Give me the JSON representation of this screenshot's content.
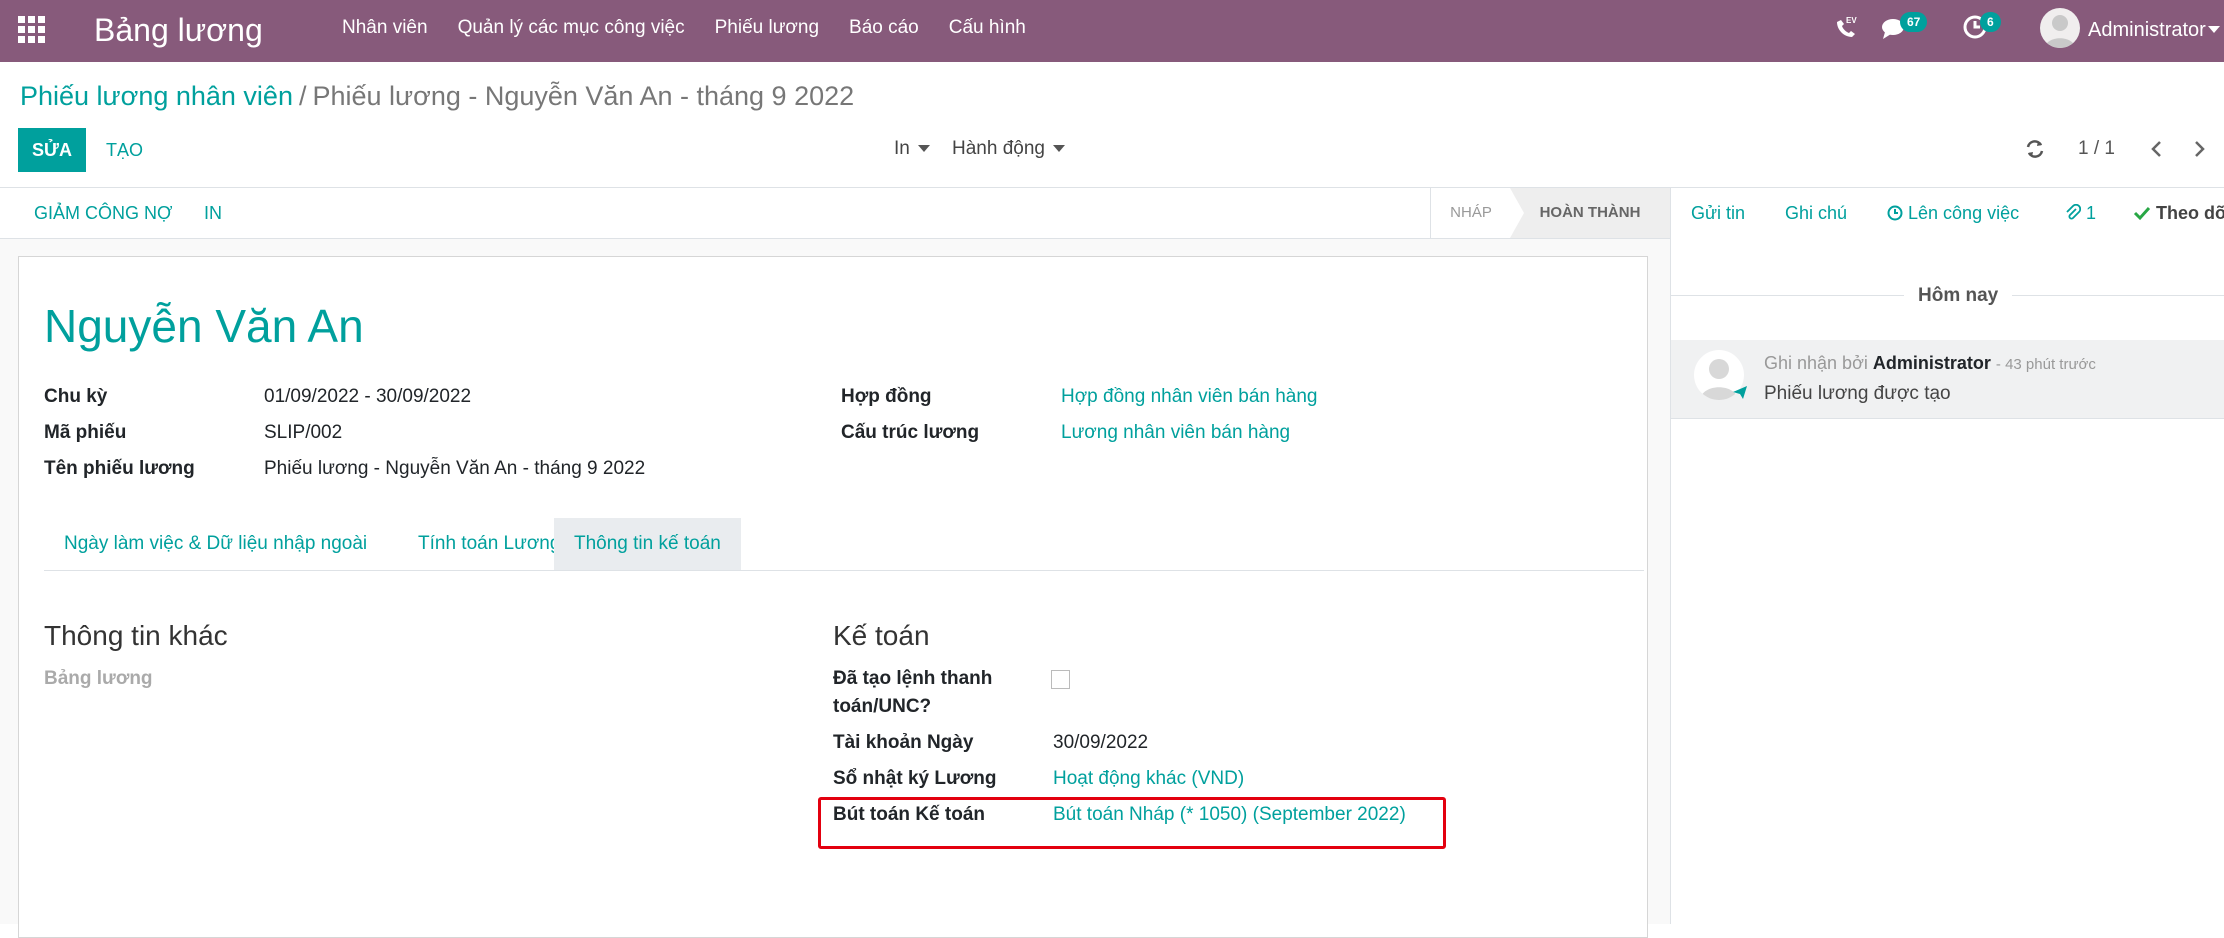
{
  "navbar": {
    "app_title": "Bảng lương",
    "menu": [
      "Nhân viên",
      "Quản lý các mục công việc",
      "Phiếu lương",
      "Báo cáo",
      "Cấu hình"
    ],
    "phone_label": "EV",
    "messages_count": "67",
    "activities_count": "6",
    "user_name": "Administrator",
    "colors": {
      "bar": "#875a7b",
      "badge": "#00a09d"
    }
  },
  "control_panel": {
    "breadcrumb_parent": "Phiếu lương nhân viên",
    "breadcrumb_separator": "/",
    "breadcrumb_current": "Phiếu lương - Nguyễn Văn An - tháng 9 2022",
    "edit_label": "SỬA",
    "create_label": "TẠO",
    "print_label": "In",
    "action_label": "Hành động",
    "pager": "1 / 1"
  },
  "statusbar": {
    "buttons": [
      "GIẢM CÔNG NỢ",
      "IN"
    ],
    "stages": [
      "NHÁP",
      "HOÀN THÀNH"
    ],
    "active_stage": "HOÀN THÀNH"
  },
  "form": {
    "employee_name": "Nguyễn Văn An",
    "left_fields": [
      {
        "label": "Chu kỳ",
        "value": "01/09/2022 - 30/09/2022"
      },
      {
        "label": "Mã phiếu",
        "value": "SLIP/002"
      },
      {
        "label": "Tên phiếu lương",
        "value": "Phiếu lương - Nguyễn Văn An - tháng 9 2022"
      }
    ],
    "right_fields": [
      {
        "label": "Hợp đồng",
        "value": "Hợp đồng nhân viên bán hàng"
      },
      {
        "label": "Cấu trúc lương",
        "value": "Lương nhân viên bán hàng"
      }
    ],
    "tabs": [
      "Ngày làm việc & Dữ liệu nhập ngoài",
      "Tính toán Lương",
      "Thông tin kế toán"
    ],
    "active_tab": "Thông tin kế toán",
    "other_info": {
      "title": "Thông tin khác",
      "field_label": "Bảng lương"
    },
    "accounting": {
      "title": "Kế toán",
      "payment_label": "Đã tạo lệnh thanh toán/UNC?",
      "payment_label_line1": "Đã tạo lệnh thanh",
      "payment_label_line2": "toán/UNC?",
      "payment_checked": false,
      "date_label": "Tài khoản Ngày",
      "date_value": "30/09/2022",
      "journal_label": "Sổ nhật ký Lương",
      "journal_value": "Hoạt động khác (VND)",
      "move_label": "Bút toán Kế toán",
      "move_value": "Bút toán Nháp (* 1050) (September 2022)"
    }
  },
  "chatter": {
    "send_message": "Gửi tin",
    "log_note": "Ghi chú",
    "schedule_activity": "Lên công việc",
    "attachments_count": "1",
    "follow": "Theo dõ",
    "today_label": "Hôm nay",
    "message": {
      "prefix": "Ghi nhận bởi",
      "author": "Administrator",
      "time": "- 43 phút trước",
      "body": "Phiếu lương được tạo"
    }
  }
}
